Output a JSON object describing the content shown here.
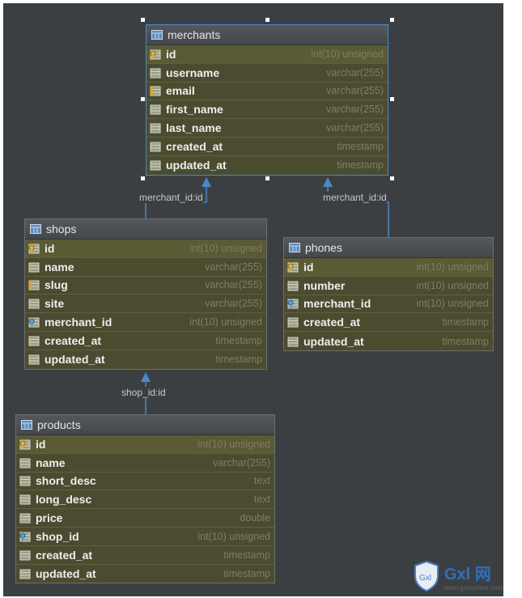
{
  "colors": {
    "background": "#3c3f41",
    "table_body": "#4b4c2f",
    "header": "#4e5153",
    "selection": "#4a88c7",
    "edge": "#4a88c7",
    "type_text": "#7d7e64"
  },
  "tables": {
    "merchants": {
      "name": "merchants",
      "columns": [
        {
          "name": "id",
          "type": "int(10) unsigned",
          "icon": "primary-key-icon"
        },
        {
          "name": "username",
          "type": "varchar(255)",
          "icon": "column-icon"
        },
        {
          "name": "email",
          "type": "varchar(255)",
          "icon": "unique-column-icon"
        },
        {
          "name": "first_name",
          "type": "varchar(255)",
          "icon": "column-icon"
        },
        {
          "name": "last_name",
          "type": "varchar(255)",
          "icon": "column-icon"
        },
        {
          "name": "created_at",
          "type": "timestamp",
          "icon": "column-icon"
        },
        {
          "name": "updated_at",
          "type": "timestamp",
          "icon": "column-icon"
        }
      ]
    },
    "shops": {
      "name": "shops",
      "columns": [
        {
          "name": "id",
          "type": "int(10) unsigned",
          "icon": "primary-key-icon"
        },
        {
          "name": "name",
          "type": "varchar(255)",
          "icon": "column-icon"
        },
        {
          "name": "slug",
          "type": "varchar(255)",
          "icon": "unique-column-icon"
        },
        {
          "name": "site",
          "type": "varchar(255)",
          "icon": "column-icon"
        },
        {
          "name": "merchant_id",
          "type": "int(10) unsigned",
          "icon": "foreign-key-icon"
        },
        {
          "name": "created_at",
          "type": "timestamp",
          "icon": "column-icon"
        },
        {
          "name": "updated_at",
          "type": "timestamp",
          "icon": "column-icon"
        }
      ]
    },
    "phones": {
      "name": "phones",
      "columns": [
        {
          "name": "id",
          "type": "int(10) unsigned",
          "icon": "primary-key-icon"
        },
        {
          "name": "number",
          "type": "int(10) unsigned",
          "icon": "column-icon"
        },
        {
          "name": "merchant_id",
          "type": "int(10) unsigned",
          "icon": "foreign-key-icon"
        },
        {
          "name": "created_at",
          "type": "timestamp",
          "icon": "column-icon"
        },
        {
          "name": "updated_at",
          "type": "timestamp",
          "icon": "column-icon"
        }
      ]
    },
    "products": {
      "name": "products",
      "columns": [
        {
          "name": "id",
          "type": "int(10) unsigned",
          "icon": "primary-key-icon"
        },
        {
          "name": "name",
          "type": "varchar(255)",
          "icon": "column-icon"
        },
        {
          "name": "short_desc",
          "type": "text",
          "icon": "column-icon"
        },
        {
          "name": "long_desc",
          "type": "text",
          "icon": "column-icon"
        },
        {
          "name": "price",
          "type": "double",
          "icon": "column-icon"
        },
        {
          "name": "shop_id",
          "type": "int(10) unsigned",
          "icon": "foreign-key-icon"
        },
        {
          "name": "created_at",
          "type": "timestamp",
          "icon": "column-icon"
        },
        {
          "name": "updated_at",
          "type": "timestamp",
          "icon": "column-icon"
        }
      ]
    }
  },
  "relations": [
    {
      "label": "merchant_id:id",
      "from": "shops",
      "to": "merchants"
    },
    {
      "label": "merchant_id:id",
      "from": "phones",
      "to": "merchants"
    },
    {
      "label": "shop_id:id",
      "from": "products",
      "to": "shops"
    }
  ],
  "watermark": {
    "text": "Gxl 网",
    "subtext": "www.gxlsystem.com"
  }
}
